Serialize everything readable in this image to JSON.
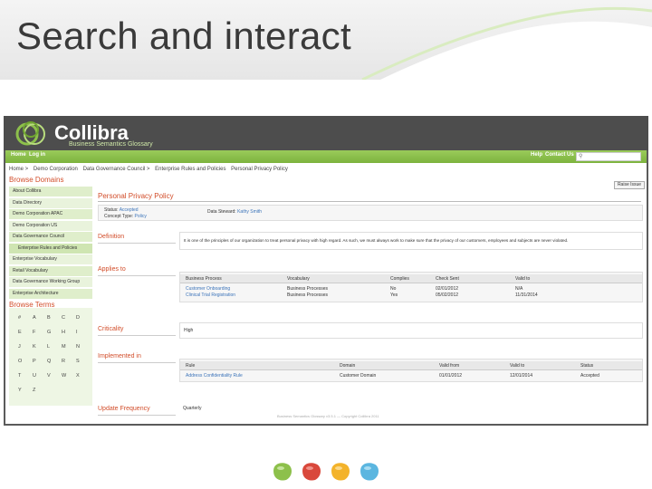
{
  "slide": {
    "title": "Search and interact"
  },
  "app": {
    "logo_name": "Collibra",
    "logo_subtitle": "Business Semantics Glossary",
    "nav": {
      "home": "Home",
      "login": "Log in",
      "help": "Help",
      "contact": "Contact Us"
    },
    "search": {
      "placeholder": ""
    },
    "breadcrumb": [
      "Home >",
      "Demo Corporation",
      "Data Governance Council >",
      "Enterprise Rules and Policies",
      "Personal Privacy Policy"
    ]
  },
  "sidebar": {
    "browse_domains_heading": "Browse Domains",
    "domains": [
      "About Collibra",
      "Data Directory",
      "Demo Corporation APAC",
      "Demo Corporation US",
      "Data Governance Council",
      "Enterprise Rules and Policies",
      "Enterprise Vocabulary",
      "Retail Vocabulary",
      "Data Governance Working Group",
      "Enterprise Architecture"
    ],
    "browse_terms_heading": "Browse Terms",
    "letters": [
      "#",
      "A",
      "B",
      "C",
      "D",
      "E",
      "F",
      "G",
      "H",
      "I",
      "J",
      "K",
      "L",
      "M",
      "N",
      "O",
      "P",
      "Q",
      "R",
      "S",
      "T",
      "U",
      "V",
      "W",
      "X",
      "Y",
      "Z"
    ]
  },
  "main": {
    "title": "Personal Privacy Policy",
    "raise_issue": "Raise Issue",
    "status_label": "Status:",
    "status_value": "Accepted",
    "concept_type_label": "Concept Type:",
    "concept_type_value": "Policy",
    "steward_label": "Data Steward:",
    "steward_value": "Kathy Smith",
    "definition_heading": "Definition",
    "definition_text": "It is one of the principles of our organization to treat personal privacy with high regard. As such, we must always work to make sure that the privacy of our customers, employees and subjects are never violated.",
    "applies_heading": "Applies to",
    "applies_columns": [
      "Business Process",
      "Vocabulary",
      "Complies",
      "Check Sent",
      "Valid to"
    ],
    "applies_rows": [
      [
        "Customer Onboarding",
        "Business Processes",
        "No",
        "02/01/2012",
        "N/A"
      ],
      [
        "Clinical Trial Registration",
        "Business Processes",
        "Yes",
        "05/02/2012",
        "11/31/2014"
      ]
    ],
    "criticality_heading": "Criticality",
    "criticality_value": "High",
    "implemented_heading": "Implemented in",
    "implemented_columns": [
      "Rule",
      "Domain",
      "Valid from",
      "Valid to",
      "Status"
    ],
    "implemented_rows": [
      [
        "Address Confidentiality Rule",
        "Customer Domain",
        "01/01/2012",
        "12/01/2014",
        "Accepted"
      ]
    ],
    "update_heading": "Update Frequency",
    "update_value": "Quarterly",
    "footer": "Business Semantics Glossary v3.5.1 — Copyright Collibra 2011"
  },
  "colors": {
    "brand_green": "#8dc04b",
    "heading_orange": "#d24d2a",
    "link_blue": "#3b73b9"
  }
}
